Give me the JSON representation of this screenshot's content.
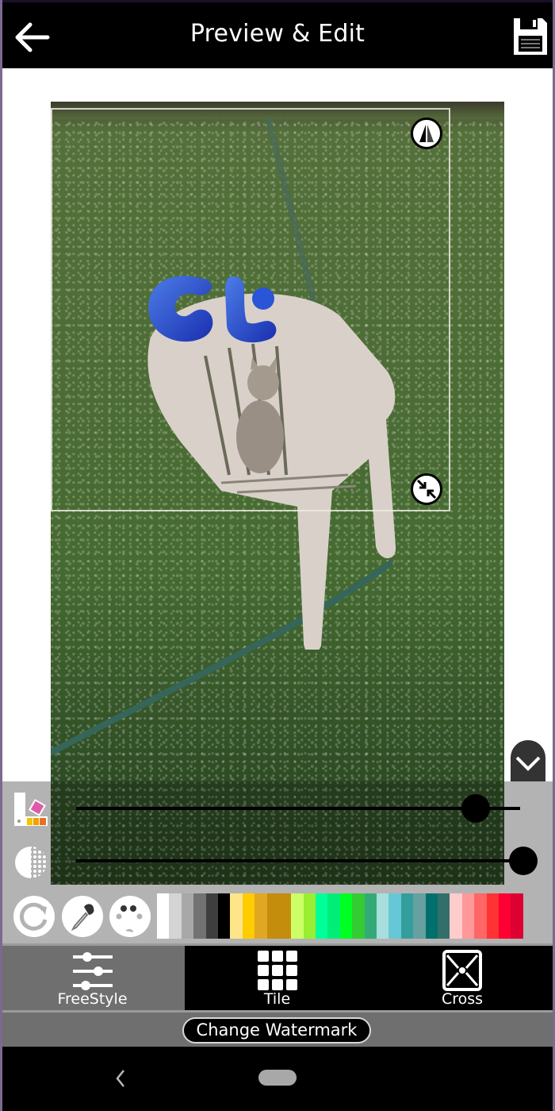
{
  "header": {
    "title": "Preview & Edit",
    "back_icon": "arrow-left-icon",
    "save_icon": "floppy-disk-icon"
  },
  "editor": {
    "watermark_text": "GT",
    "watermark_color": "#2c54d6",
    "flip_icon": "flip-horizontal-icon",
    "resize_icon": "resize-arrows-icon"
  },
  "controls": {
    "collapse_icon": "chevron-down-icon",
    "size_icon": "size-color-icon",
    "opacity_icon": "opacity-icon",
    "size_value": 0.9,
    "opacity_value": 1.0,
    "rotate_icon": "rotate-icon",
    "picker_icon": "eyedropper-icon",
    "palette_icon": "palette-icon",
    "swatches": [
      "#ffffff",
      "#d4d4d4",
      "#a8a8a8",
      "#727272",
      "#3e3e3e",
      "#000000",
      "#ffe58a",
      "#ffcc00",
      "#e0a722",
      "#c48d0c",
      "#c48d0c",
      "#ccff66",
      "#99ee33",
      "#00ff99",
      "#00ee77",
      "#00ff22",
      "#33cc33",
      "#33aa77",
      "#a8dedd",
      "#66c8d6",
      "#339e9c",
      "#66a0a0",
      "#00706c",
      "#336f6a",
      "#ffcccc",
      "#ff9999",
      "#ff6666",
      "#ff3333",
      "#ff0033",
      "#dd0033"
    ]
  },
  "modes": [
    {
      "label": "FreeStyle",
      "icon": "sliders-icon",
      "active": true
    },
    {
      "label": "Tile",
      "icon": "grid-icon",
      "active": false
    },
    {
      "label": "Cross",
      "icon": "cross-box-icon",
      "active": false
    }
  ],
  "footer": {
    "change_watermark_label": "Change Watermark"
  },
  "navbar": {
    "back_icon": "nav-back-icon",
    "home_icon": "nav-home-pill-icon"
  }
}
